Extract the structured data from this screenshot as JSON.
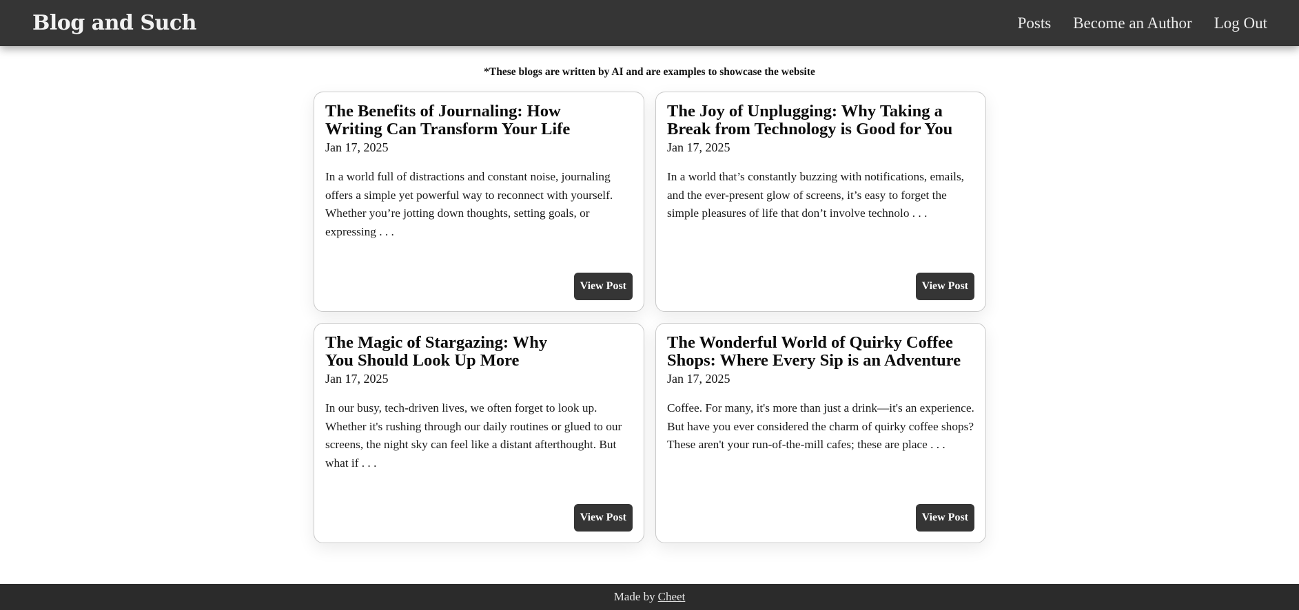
{
  "header": {
    "brand": "Blog and Such",
    "nav": [
      "Posts",
      "Become an Author",
      "Log Out"
    ]
  },
  "disclaimer": "*These blogs are written by AI and are examples to showcase the website",
  "posts": [
    {
      "title": "The Benefits of Journaling: How Writing Can Transform Your Life",
      "date": "Jan 17, 2025",
      "excerpt": "In a world full of distractions and constant noise, journaling offers a simple yet powerful way to reconnect with yourself. Whether you’re jotting down thoughts, setting goals, or expressing . . .",
      "button": "View Post"
    },
    {
      "title": "The Joy of Unplugging: Why Taking a Break from Technology is Good for You",
      "date": "Jan 17, 2025",
      "excerpt": "In a world that’s constantly buzzing with notifications, emails, and the ever-present glow of screens, it’s easy to forget the simple pleasures of life that don’t involve technolo . . .",
      "button": "View Post"
    },
    {
      "title": "The Magic of Stargazing: Why You Should Look Up More",
      "date": "Jan 17, 2025",
      "excerpt": "In our busy, tech-driven lives, we often forget to look up. Whether it's rushing through our daily routines or glued to our screens, the night sky can feel like a distant afterthought. But what if . . .",
      "button": "View Post"
    },
    {
      "title": "The Wonderful World of Quirky Coffee Shops: Where Every Sip is an Adventure",
      "date": "Jan 17, 2025",
      "excerpt": "Coffee. For many, it's more than just a drink—it's an experience. But have you ever considered the charm of quirky coffee shops? These aren't your run-of-the-mill cafes; these are place . . .",
      "button": "View Post"
    }
  ],
  "footer": {
    "text": "Made by",
    "link": "Cheet"
  },
  "colors": {
    "navbar": "#353535",
    "footer": "#2b2b2b",
    "button": "#353535",
    "card_border": "#c9c9c9"
  }
}
